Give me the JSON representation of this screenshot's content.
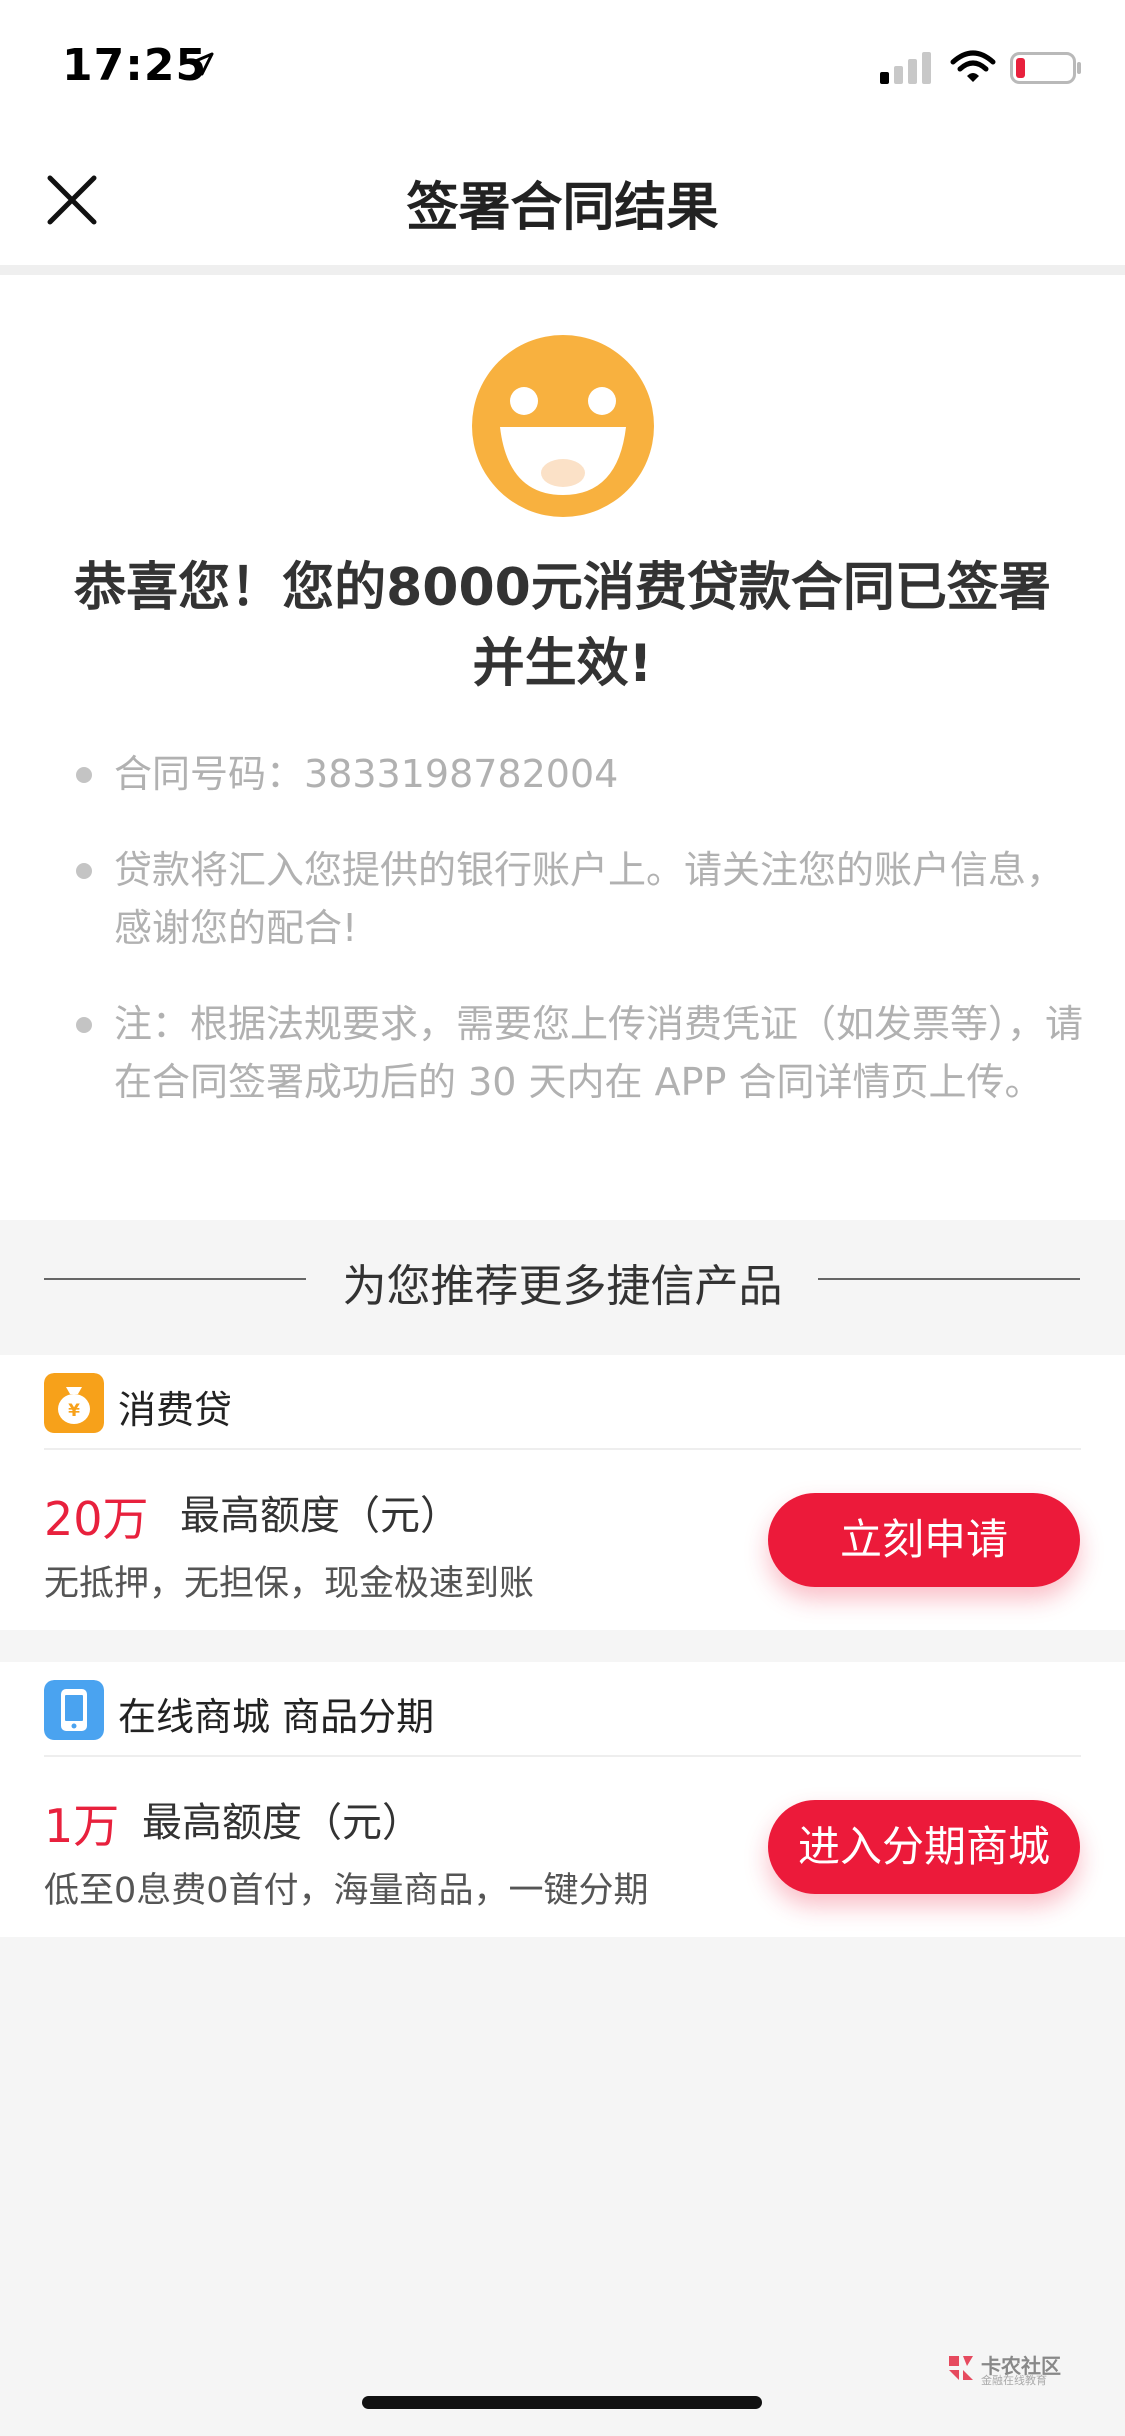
{
  "status_bar": {
    "time": "17:25"
  },
  "nav": {
    "title": "签署合同结果"
  },
  "result": {
    "headline_line1": "恭喜您！您的8000元消费贷款合同已签署",
    "headline_line2": "并生效!",
    "contract_no_label": "合同号码：",
    "contract_no": "3833198782004",
    "info_2": "贷款将汇入您提供的银行账户上。请关注您的账户信息，感谢您的配合!",
    "info_3": "注：根据法规要求，需要您上传消费凭证（如发票等），请在合同签署成功后的 30 天内在 APP 合同详情页上传。"
  },
  "recommend": {
    "title": "为您推荐更多捷信产品"
  },
  "products": [
    {
      "name": "消费贷",
      "amount": "20万",
      "amount_label": "最高额度（元）",
      "desc": "无抵押，无担保，现金极速到账",
      "button": "立刻申请",
      "icon": "money-bag-icon",
      "icon_color": "#f7a11a"
    },
    {
      "name": "在线商城 商品分期",
      "amount": "1万",
      "amount_label": "最高额度（元）",
      "desc": "低至0息费0首付，海量商品，一键分期",
      "button": "进入分期商城",
      "icon": "phone-icon",
      "icon_color": "#4aa3f0"
    }
  ],
  "watermark": {
    "title": "卡农社区",
    "subtitle": "金融在线教育"
  },
  "colors": {
    "accent": "#ec1a3a",
    "smiley": "#f8b13f"
  }
}
